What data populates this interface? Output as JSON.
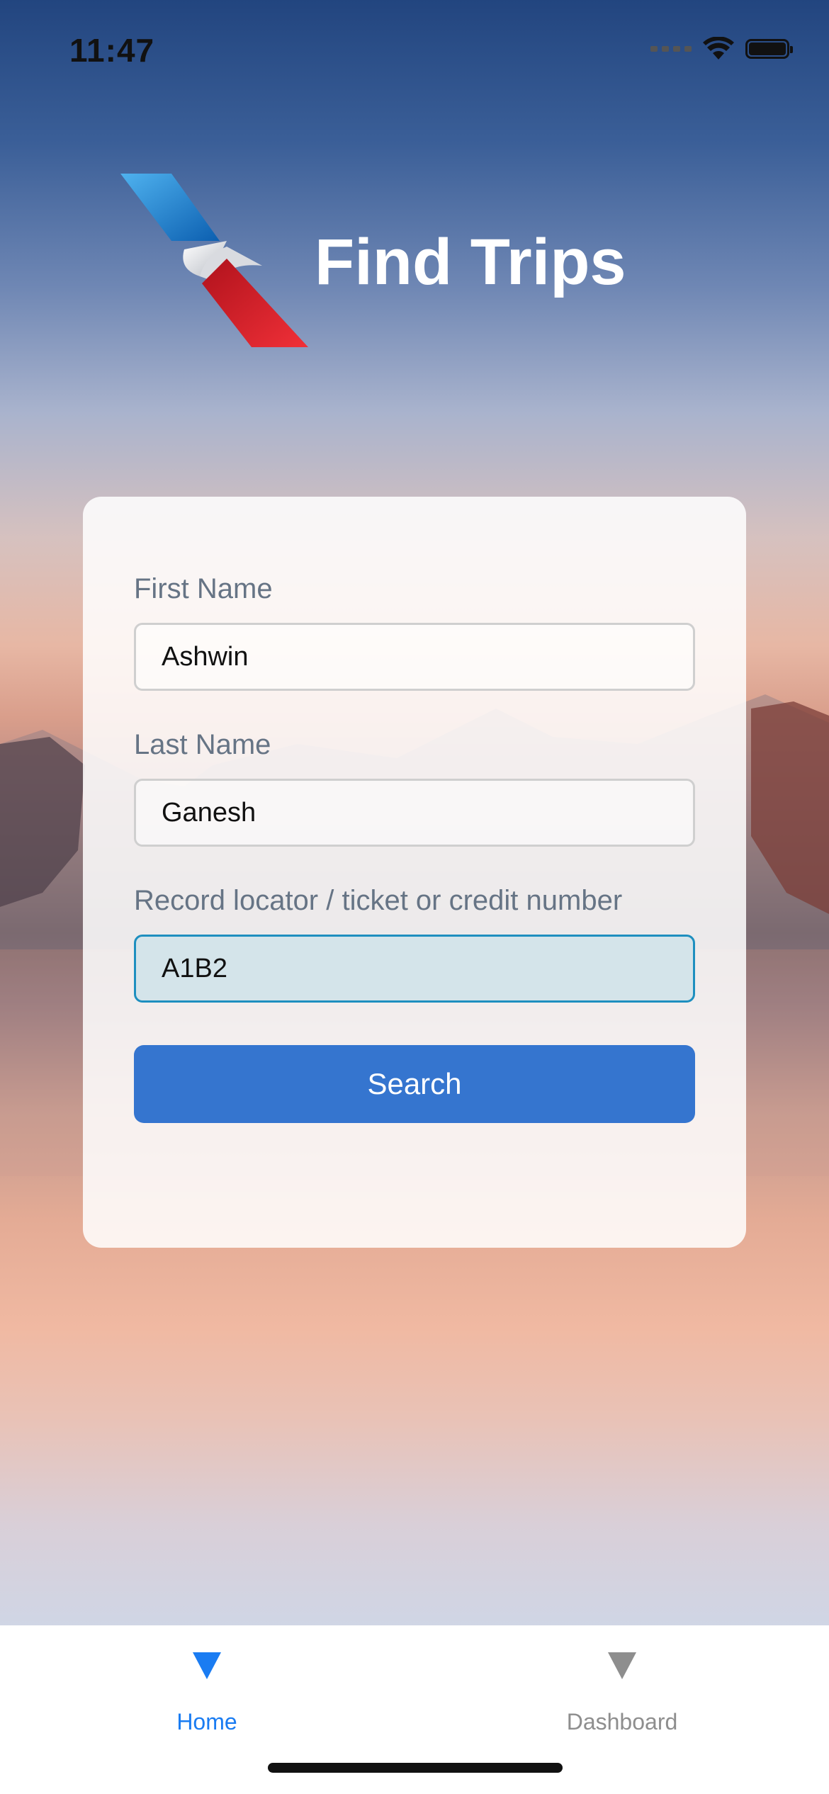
{
  "status_bar": {
    "time": "11:47",
    "icons": [
      "signal-icon",
      "wifi-icon",
      "battery-icon"
    ]
  },
  "header": {
    "logo": "airline-logo",
    "title": "Find Trips"
  },
  "form": {
    "first_name": {
      "label": "First Name",
      "value": "Ashwin"
    },
    "last_name": {
      "label": "Last Name",
      "value": "Ganesh"
    },
    "record_locator": {
      "label": "Record locator / ticket or credit number",
      "value": "A1B2"
    },
    "search_label": "Search"
  },
  "tabbar": {
    "tabs": [
      {
        "label": "Home",
        "icon": "triangle-down-icon",
        "active": true
      },
      {
        "label": "Dashboard",
        "icon": "triangle-down-icon",
        "active": false
      }
    ]
  },
  "colors": {
    "accent": "#3575cf",
    "tab_active": "#1a7cf2",
    "tab_inactive": "#8e8e8e",
    "label": "#667485",
    "focus_border": "#1e8fbf"
  }
}
